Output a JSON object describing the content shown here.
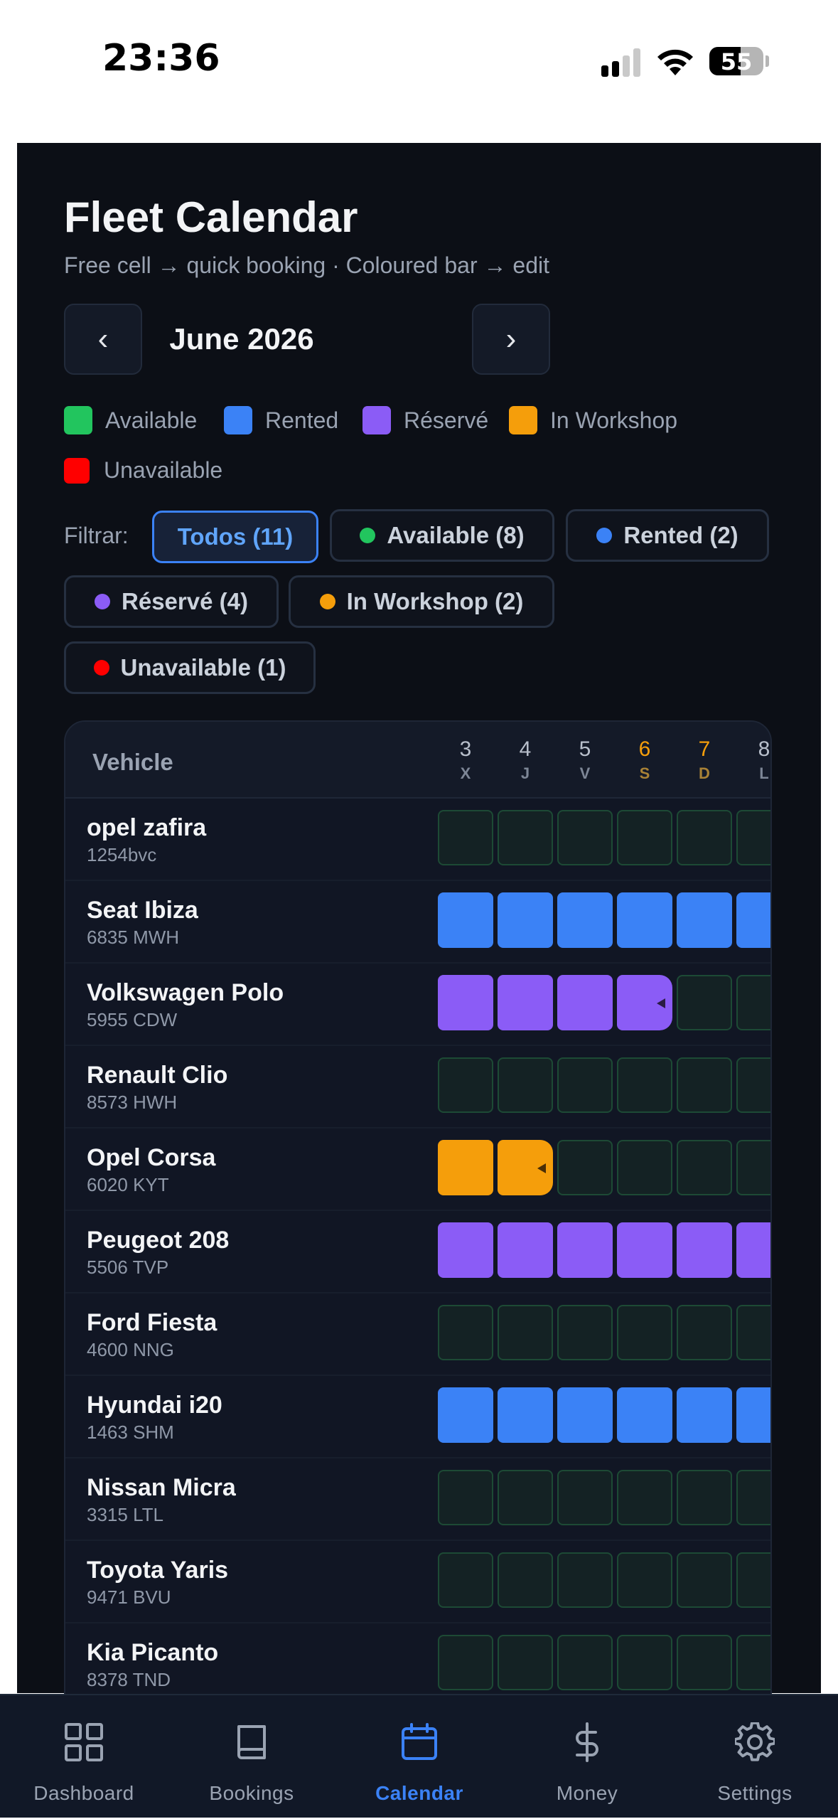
{
  "status_bar": {
    "time": "23:36",
    "battery": "55"
  },
  "header": {
    "title": "Fleet Calendar",
    "subtitle": "Free cell → quick booking · Coloured bar → edit",
    "prev_label": "‹",
    "next_label": "›",
    "month": "June 2026"
  },
  "colors": {
    "available": "#22c55e",
    "rented": "#3b82f6",
    "reserved": "#8b5cf6",
    "workshop": "#f59e0b",
    "unavailable": "#ff0000"
  },
  "legend": [
    "Available",
    "Rented",
    "Réservé",
    "In Workshop",
    "Unavailable"
  ],
  "filters": {
    "label": "Filtrar:",
    "chips": [
      "Todos (11)",
      "Available (8)",
      "Rented (2)",
      "Réservé (4)",
      "In Workshop (2)",
      "Unavailable (1)"
    ]
  },
  "table": {
    "vehicle_header": "Vehicle",
    "days": [
      {
        "num": "3",
        "dow": "X"
      },
      {
        "num": "4",
        "dow": "J"
      },
      {
        "num": "5",
        "dow": "V"
      },
      {
        "num": "6",
        "dow": "S"
      },
      {
        "num": "7",
        "dow": "D"
      },
      {
        "num": "8",
        "dow": "L"
      }
    ],
    "rows": [
      {
        "name": "opel zafira",
        "plate": "1254bvc",
        "cells": [
          "free",
          "free",
          "free",
          "free",
          "free",
          "free"
        ]
      },
      {
        "name": "Seat Ibiza",
        "plate": "6835 MWH",
        "cells": [
          "rented",
          "rented",
          "rented",
          "rented",
          "rented",
          "rented"
        ]
      },
      {
        "name": "Volkswagen Polo",
        "plate": "5955 CDW",
        "cells": [
          "reserved",
          "reserved",
          "reserved",
          "reserved-end",
          "free",
          "free"
        ]
      },
      {
        "name": "Renault Clio",
        "plate": "8573 HWH",
        "cells": [
          "free",
          "free",
          "free",
          "free",
          "free",
          "free"
        ]
      },
      {
        "name": "Opel Corsa",
        "plate": "6020 KYT",
        "cells": [
          "workshop",
          "workshop-end",
          "free",
          "free",
          "free",
          "free"
        ]
      },
      {
        "name": "Peugeot 208",
        "plate": "5506 TVP",
        "cells": [
          "reserved",
          "reserved",
          "reserved",
          "reserved",
          "reserved",
          "reserved"
        ]
      },
      {
        "name": "Ford Fiesta",
        "plate": "4600 NNG",
        "cells": [
          "free",
          "free",
          "free",
          "free",
          "free",
          "free"
        ]
      },
      {
        "name": "Hyundai i20",
        "plate": "1463 SHM",
        "cells": [
          "rented",
          "rented",
          "rented",
          "rented",
          "rented",
          "rented"
        ]
      },
      {
        "name": "Nissan Micra",
        "plate": "3315 LTL",
        "cells": [
          "free",
          "free",
          "free",
          "free",
          "free",
          "free"
        ]
      },
      {
        "name": "Toyota Yaris",
        "plate": "9471 BVU",
        "cells": [
          "free",
          "free",
          "free",
          "free",
          "free",
          "free"
        ]
      },
      {
        "name": "Kia Picanto",
        "plate": "8378 TND",
        "cells": [
          "free",
          "free",
          "free",
          "free",
          "free",
          "free"
        ]
      }
    ]
  },
  "tabbar": [
    {
      "label": "Dashboard",
      "icon": "grid-icon"
    },
    {
      "label": "Bookings",
      "icon": "book-icon"
    },
    {
      "label": "Calendar",
      "icon": "calendar-icon",
      "active": true
    },
    {
      "label": "Money",
      "icon": "dollar-icon"
    },
    {
      "label": "Settings",
      "icon": "gear-icon"
    }
  ]
}
